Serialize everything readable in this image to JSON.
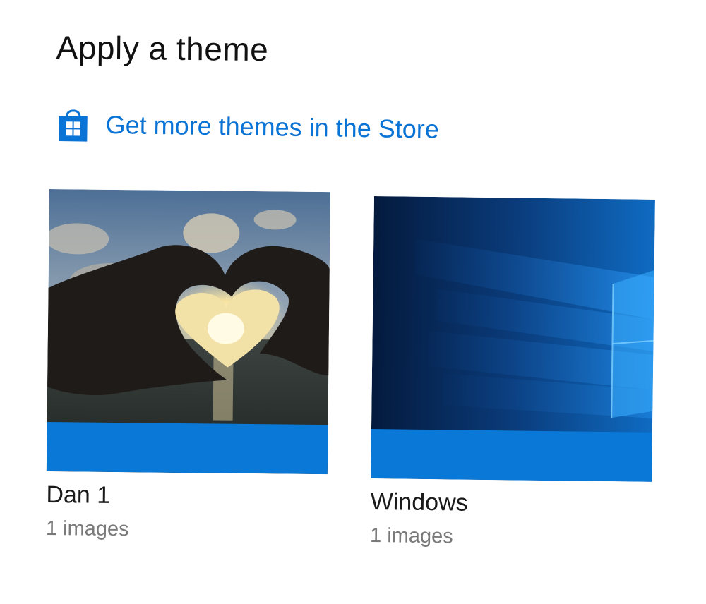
{
  "header": {
    "title": "Apply a theme"
  },
  "store": {
    "link_label": "Get more themes in the Store",
    "icon": "store-bag-icon",
    "link_color": "#0a73d6"
  },
  "accent_color": "#0a78d7",
  "themes": [
    {
      "name": "Dan 1",
      "count_label": "1 images",
      "thumbnail": "heart-hands-sunset-image"
    },
    {
      "name": "Windows",
      "count_label": "1 images",
      "thumbnail": "windows-hero-wallpaper-image"
    }
  ]
}
